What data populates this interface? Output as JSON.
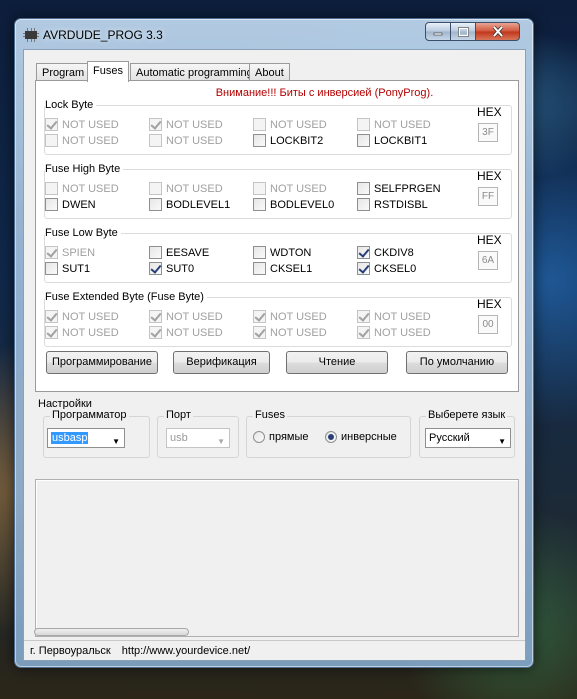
{
  "window": {
    "title": "AVRDUDE_PROG 3.3"
  },
  "tabs": [
    {
      "label": "Program",
      "active": false
    },
    {
      "label": "Fuses",
      "active": true
    },
    {
      "label": "Automatic programming",
      "active": false
    },
    {
      "label": "About",
      "active": false
    }
  ],
  "warning": "Внимание!!! Биты с инверсией (PonyProg).",
  "hex_label": "HEX",
  "groups": [
    {
      "title": "Lock Byte",
      "hex": "3F",
      "fuses": [
        {
          "label": "NOT USED",
          "checked": true,
          "enabled": false
        },
        {
          "label": "NOT USED",
          "checked": true,
          "enabled": false
        },
        {
          "label": "NOT USED",
          "checked": false,
          "enabled": false
        },
        {
          "label": "NOT USED",
          "checked": false,
          "enabled": false
        },
        {
          "label": "NOT USED",
          "checked": false,
          "enabled": false
        },
        {
          "label": "NOT USED",
          "checked": false,
          "enabled": false
        },
        {
          "label": "LOCKBIT2",
          "checked": false,
          "enabled": true
        },
        {
          "label": "LOCKBIT1",
          "checked": false,
          "enabled": true
        }
      ]
    },
    {
      "title": "Fuse High Byte",
      "hex": "FF",
      "fuses": [
        {
          "label": "NOT USED",
          "checked": false,
          "enabled": false
        },
        {
          "label": "NOT USED",
          "checked": false,
          "enabled": false
        },
        {
          "label": "NOT USED",
          "checked": false,
          "enabled": false
        },
        {
          "label": "SELFPRGEN",
          "checked": false,
          "enabled": true
        },
        {
          "label": "DWEN",
          "checked": false,
          "enabled": true
        },
        {
          "label": "BODLEVEL1",
          "checked": false,
          "enabled": true
        },
        {
          "label": "BODLEVEL0",
          "checked": false,
          "enabled": true
        },
        {
          "label": "RSTDISBL",
          "checked": false,
          "enabled": true
        }
      ]
    },
    {
      "title": "Fuse Low Byte",
      "hex": "6A",
      "fuses": [
        {
          "label": "SPIEN",
          "checked": true,
          "enabled": false
        },
        {
          "label": "EESAVE",
          "checked": false,
          "enabled": true
        },
        {
          "label": "WDTON",
          "checked": false,
          "enabled": true
        },
        {
          "label": "CKDIV8",
          "checked": true,
          "enabled": true
        },
        {
          "label": "SUT1",
          "checked": false,
          "enabled": true
        },
        {
          "label": "SUT0",
          "checked": true,
          "enabled": true
        },
        {
          "label": "CKSEL1",
          "checked": false,
          "enabled": true
        },
        {
          "label": "CKSEL0",
          "checked": true,
          "enabled": true
        }
      ]
    },
    {
      "title": "Fuse Extended Byte (Fuse Byte)",
      "hex": "00",
      "fuses": [
        {
          "label": "NOT USED",
          "checked": true,
          "enabled": false
        },
        {
          "label": "NOT USED",
          "checked": true,
          "enabled": false
        },
        {
          "label": "NOT USED",
          "checked": true,
          "enabled": false
        },
        {
          "label": "NOT USED",
          "checked": true,
          "enabled": false
        },
        {
          "label": "NOT USED",
          "checked": true,
          "enabled": false
        },
        {
          "label": "NOT USED",
          "checked": true,
          "enabled": false
        },
        {
          "label": "NOT USED",
          "checked": true,
          "enabled": false
        },
        {
          "label": "NOT USED",
          "checked": true,
          "enabled": false
        }
      ]
    }
  ],
  "buttons": {
    "program": "Программирование",
    "verify": "Верификация",
    "read": "Чтение",
    "default": "По умолчанию"
  },
  "settings": {
    "title": "Настройки",
    "programmer": {
      "label": "Программатор",
      "value": "usbasp"
    },
    "port": {
      "label": "Порт",
      "value": "usb"
    },
    "fuses": {
      "label": "Fuses",
      "option_direct": "прямые",
      "option_inverse": "инверсные",
      "selected": "инверсные"
    },
    "language": {
      "label": "Выберете язык",
      "value": "Русский"
    }
  },
  "status": {
    "city": "г. Первоуральск",
    "url": "http://www.yourdevice.net/"
  }
}
